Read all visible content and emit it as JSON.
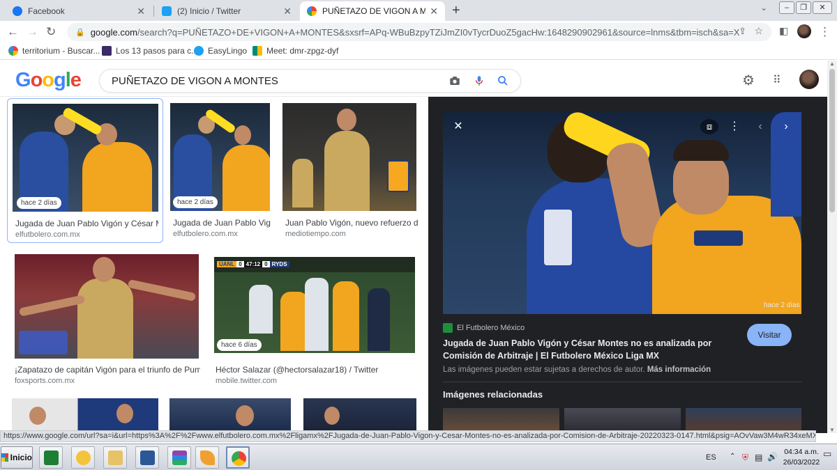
{
  "browser": {
    "tabs": [
      {
        "title": "Facebook",
        "active": false
      },
      {
        "title": "(2) Inicio / Twitter",
        "active": false
      },
      {
        "title": "PUÑETAZO DE VIGON A MONTE",
        "active": true
      }
    ],
    "url_domain": "google.com",
    "url_rest": "/search?q=PUÑETAZO+DE+VIGON+A+MONTES&sxsrf=APq-WBuBzpyTZiJmZI0vTycrDuoZ5gacHw:1648290902961&source=lnms&tbm=isch&sa=X&ved=2...",
    "bookmarks": [
      {
        "label": "territorium - Buscar...",
        "color": "#3f51b5"
      },
      {
        "label": "Los 13 pasos para c...",
        "color": "#3a2a66"
      },
      {
        "label": "EasyLingo",
        "color": "#1ea1f2"
      },
      {
        "label": "Meet: dmr-zpgz-dyf",
        "color": "#00897b"
      }
    ]
  },
  "google": {
    "logo": "Google",
    "query": "PUÑETAZO DE VIGON A MONTES"
  },
  "results": [
    {
      "caption": "Jugada de Juan Pablo Vigón y César M...",
      "source": "elfutbolero.com.mx",
      "badge": "hace 2 días"
    },
    {
      "caption": "Jugada de Juan Pablo Vig...",
      "source": "elfutbolero.com.mx",
      "badge": "hace 2 días"
    },
    {
      "caption": "Juan Pablo Vigón, nuevo refuerzo de...",
      "source": "mediotiempo.com",
      "badge": ""
    },
    {
      "caption": "¡Zapatazo de capitán Vigón para el triunfo de Pumas...",
      "source": "foxsports.com.mx",
      "badge": ""
    },
    {
      "caption": "Héctor Salazar (@hectorsalazar18) / Twitter",
      "source": "mobile.twitter.com",
      "badge": "hace 6 días"
    }
  ],
  "scoreboard": {
    "home": "UANL",
    "home_score": "0",
    "time": "47:12",
    "away_score": "0",
    "away": "RYDS"
  },
  "panel": {
    "badge": "hace 2 días",
    "source_name": "El Futbolero México",
    "title": "Jugada de Juan Pablo Vigón y César Montes no es analizada por Comisión de Arbitraje | El Futbolero México Liga MX",
    "visit_label": "Visitar",
    "copyright": "Las imágenes pueden estar sujetas a derechos de autor.",
    "more_info": "Más información",
    "related_heading": "Imágenes relacionadas"
  },
  "status_url": "https://www.google.com/url?sa=i&url=https%3A%2F%2Fwww.elfutbolero.com.mx%2Fligamx%2FJugada-de-Juan-Pablo-Vigon-y-Cesar-Montes-no-es-analizada-por-Comision-de-Arbitraje-20220323-0147.html&psig=AOvVaw3M4wR34xeMXA_ZeZu...",
  "taskbar": {
    "start_label": "Inicio",
    "lang": "ES",
    "time": "04:34 a.m.",
    "date": "26/03/2022"
  }
}
